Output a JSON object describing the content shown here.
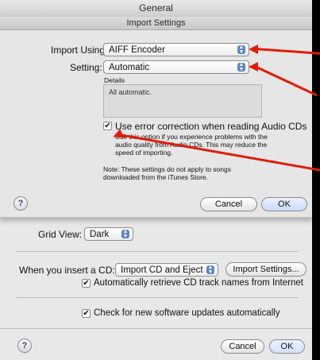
{
  "window": {
    "title": "General"
  },
  "sheet": {
    "title": "Import Settings",
    "import_using_label": "Import Using:",
    "import_using_value": "AIFF Encoder",
    "setting_label": "Setting:",
    "setting_value": "Automatic",
    "details_label": "Details",
    "details_text": "All automatic.",
    "error_correction_label": "Use error correction when reading Audio CDs",
    "error_correction_desc": "Use this option if you experience problems with the audio quality from Audio CDs. This may reduce the speed of importing.",
    "note": "Note: These settings do not apply to songs downloaded from the iTunes Store.",
    "cancel": "Cancel",
    "ok": "OK"
  },
  "general": {
    "grid_view_label": "Grid View:",
    "grid_view_value": "Dark",
    "insert_cd_label": "When you insert a CD:",
    "insert_cd_value": "Import CD and Eject",
    "import_settings_button": "Import Settings...",
    "retrieve_names_label": "Automatically retrieve CD track names from Internet",
    "check_updates_label": "Check for new software updates automatically",
    "cancel": "Cancel",
    "ok": "OK"
  },
  "icons": {
    "checkmark": "✔",
    "help": "?",
    "popup_arrows": "▲▼"
  },
  "colors": {
    "annotation_arrow": "#e21b06",
    "popup_accent": "#5a86c9"
  }
}
